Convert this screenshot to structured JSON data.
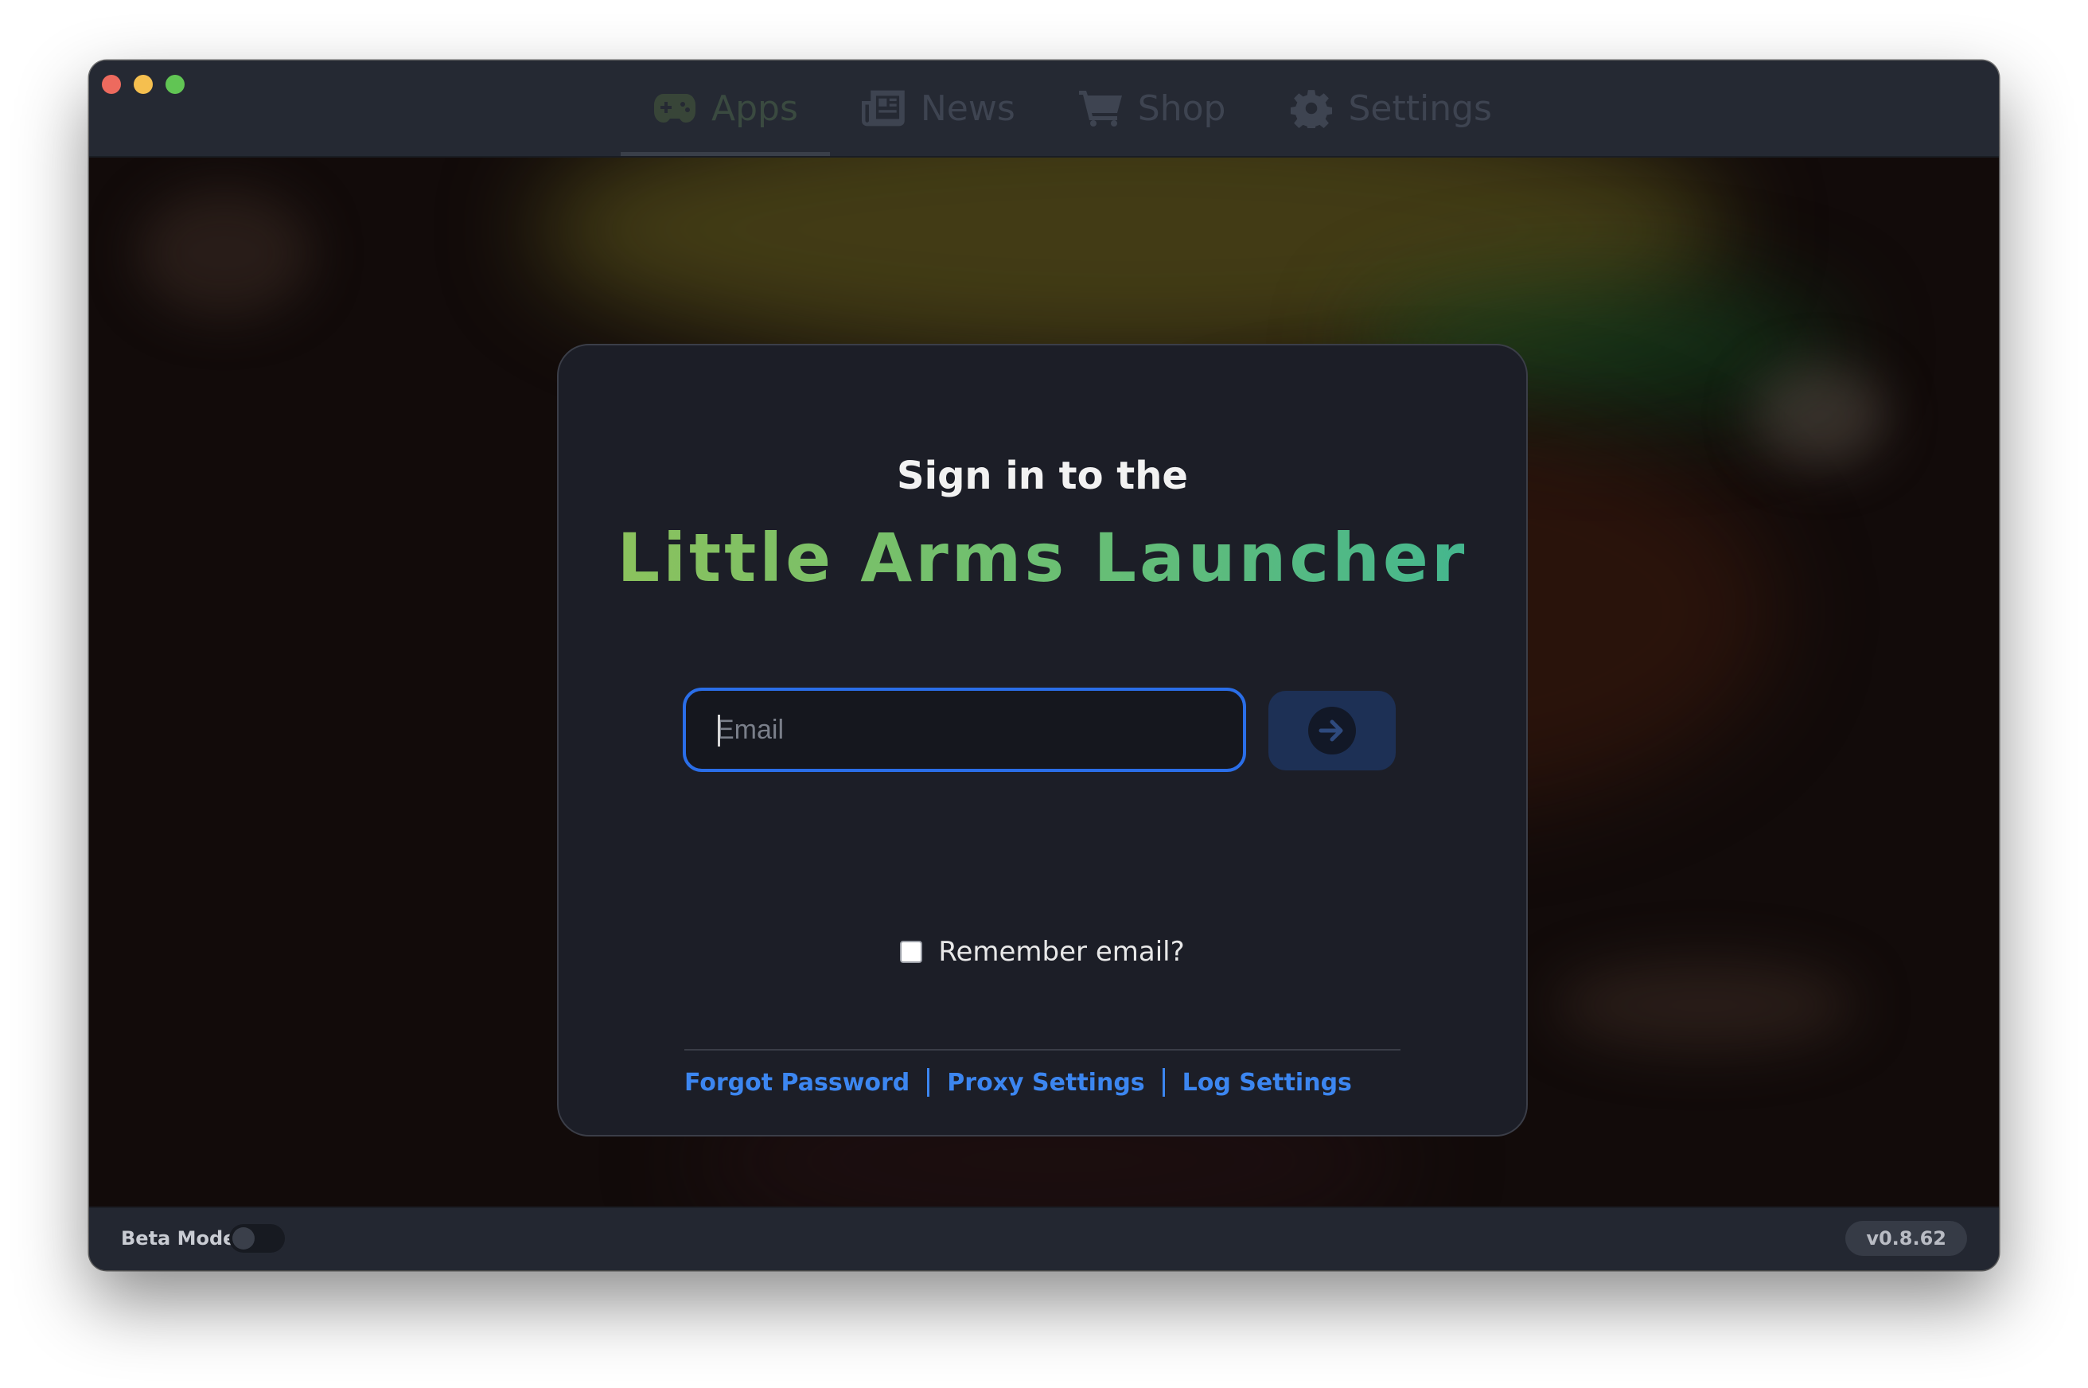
{
  "nav": {
    "tabs": [
      {
        "label": "Apps",
        "icon": "gamepad-icon",
        "active": true
      },
      {
        "label": "News",
        "icon": "newspaper-icon",
        "active": false
      },
      {
        "label": "Shop",
        "icon": "cart-icon",
        "active": false
      },
      {
        "label": "Settings",
        "icon": "gear-icon",
        "active": false
      }
    ]
  },
  "login": {
    "subtitle": "Sign in to the",
    "title": "Little Arms Launcher",
    "email_placeholder": "Email",
    "email_value": "",
    "submit_icon": "arrow-right-icon",
    "remember_label": "Remember email?",
    "remember_checked": false,
    "links": {
      "forgot": "Forgot Password",
      "proxy": "Proxy Settings",
      "log": "Log Settings"
    }
  },
  "status": {
    "beta_label": "Beta Mode",
    "beta_enabled": false,
    "version": "v0.8.62"
  },
  "colors": {
    "accent": "#2a6ee8",
    "link": "#3c86f0",
    "title_gradient_start": "#8fc25a",
    "title_gradient_end": "#3fb592"
  }
}
